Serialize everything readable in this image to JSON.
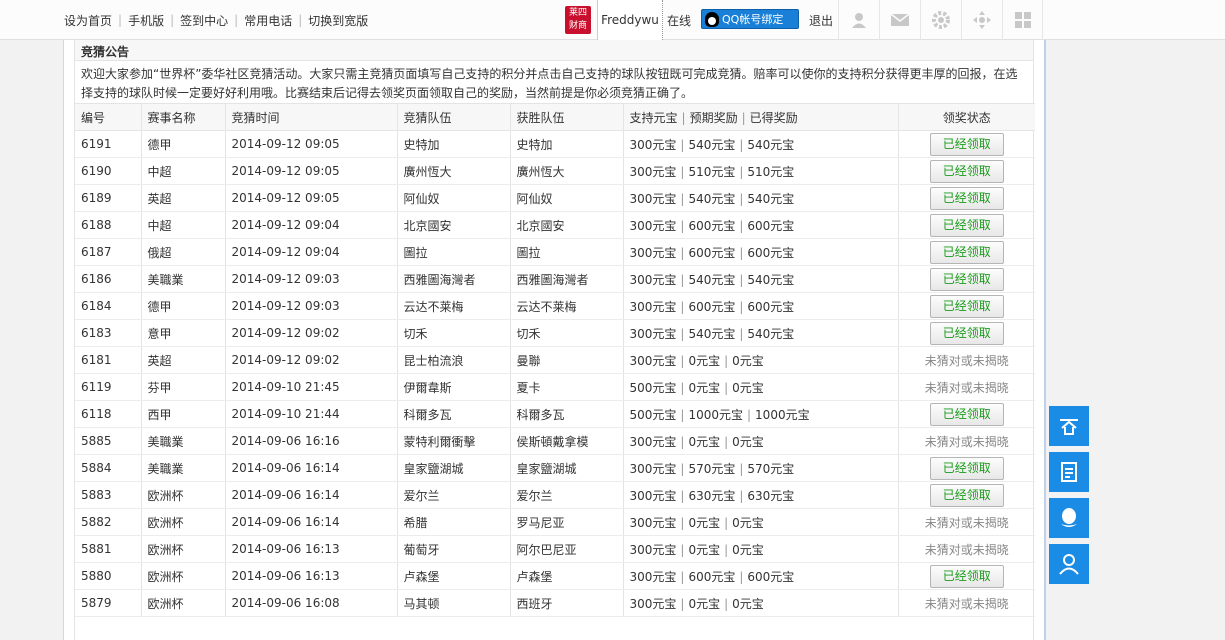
{
  "topbar": {
    "links": [
      "设为首页",
      "手机版",
      "签到中心",
      "常用电话",
      "切换到宽版"
    ],
    "logo_text": "莱四财商",
    "username": "Freddywu",
    "online": "在线",
    "qq_bind": "QQ帐号绑定",
    "logout": "退出"
  },
  "panel": {
    "title": "竞猜公告",
    "notice": "欢迎大家参加“世界杯”委华社区竞猜活动。大家只需主竞猜页面填写自己支持的积分并点击自己支持的球队按钮既可完成竞猜。赔率可以使你的支持积分获得更丰厚的回报，在选择支持的球队时候一定要好好利用哦。比赛结束后记得去领奖页面领取自己的奖励，当然前提是你必须竞猜正确了。"
  },
  "table": {
    "headers": {
      "id": "编号",
      "league": "赛事名称",
      "time": "竞猜时间",
      "team": "竞猜队伍",
      "winner": "获胜队伍",
      "stake": "支持元宝",
      "expected": "预期奖励",
      "earned": "已得奖励",
      "status": "领奖状态"
    },
    "claimed_label": "已经领取",
    "rows": [
      {
        "id": "6191",
        "league": "德甲",
        "time": "2014-09-12 09:05",
        "team": "史特加",
        "winner": "史特加",
        "stake": "300元宝",
        "expected": "540元宝",
        "earned": "540元宝",
        "status": "已经领取",
        "claimed": true
      },
      {
        "id": "6190",
        "league": "中超",
        "time": "2014-09-12 09:05",
        "team": "廣州恆大",
        "winner": "廣州恆大",
        "stake": "300元宝",
        "expected": "510元宝",
        "earned": "510元宝",
        "status": "已经领取",
        "claimed": true
      },
      {
        "id": "6189",
        "league": "英超",
        "time": "2014-09-12 09:05",
        "team": "阿仙奴",
        "winner": "阿仙奴",
        "stake": "300元宝",
        "expected": "540元宝",
        "earned": "540元宝",
        "status": "已经领取",
        "claimed": true
      },
      {
        "id": "6188",
        "league": "中超",
        "time": "2014-09-12 09:04",
        "team": "北京國安",
        "winner": "北京國安",
        "stake": "300元宝",
        "expected": "600元宝",
        "earned": "600元宝",
        "status": "已经领取",
        "claimed": true
      },
      {
        "id": "6187",
        "league": "俄超",
        "time": "2014-09-12 09:04",
        "team": "圖拉",
        "winner": "圖拉",
        "stake": "300元宝",
        "expected": "600元宝",
        "earned": "600元宝",
        "status": "已经领取",
        "claimed": true
      },
      {
        "id": "6186",
        "league": "美職業",
        "time": "2014-09-12 09:03",
        "team": "西雅圖海灣者",
        "winner": "西雅圖海灣者",
        "stake": "300元宝",
        "expected": "540元宝",
        "earned": "540元宝",
        "status": "已经领取",
        "claimed": true
      },
      {
        "id": "6184",
        "league": "德甲",
        "time": "2014-09-12 09:03",
        "team": "云达不莱梅",
        "winner": "云达不莱梅",
        "stake": "300元宝",
        "expected": "600元宝",
        "earned": "600元宝",
        "status": "已经领取",
        "claimed": true
      },
      {
        "id": "6183",
        "league": "意甲",
        "time": "2014-09-12 09:02",
        "team": "切禾",
        "winner": "切禾",
        "stake": "300元宝",
        "expected": "540元宝",
        "earned": "540元宝",
        "status": "已经领取",
        "claimed": true
      },
      {
        "id": "6181",
        "league": "英超",
        "time": "2014-09-12 09:02",
        "team": "昆士柏流浪",
        "winner": "曼聯",
        "stake": "300元宝",
        "expected": "0元宝",
        "earned": "0元宝",
        "status": "未猜对或未揭晓",
        "claimed": false
      },
      {
        "id": "6119",
        "league": "芬甲",
        "time": "2014-09-10 21:45",
        "team": "伊爾韋斯",
        "winner": "夏卡",
        "stake": "500元宝",
        "expected": "0元宝",
        "earned": "0元宝",
        "status": "未猜对或未揭晓",
        "claimed": false
      },
      {
        "id": "6118",
        "league": "西甲",
        "time": "2014-09-10 21:44",
        "team": "科爾多瓦",
        "winner": "科爾多瓦",
        "stake": "500元宝",
        "expected": "1000元宝",
        "earned": "1000元宝",
        "status": "已经领取",
        "claimed": true
      },
      {
        "id": "5885",
        "league": "美職業",
        "time": "2014-09-06 16:16",
        "team": "蒙特利爾衝擊",
        "winner": "侯斯頓戴拿模",
        "stake": "300元宝",
        "expected": "0元宝",
        "earned": "0元宝",
        "status": "未猜对或未揭晓",
        "claimed": false
      },
      {
        "id": "5884",
        "league": "美職業",
        "time": "2014-09-06 16:14",
        "team": "皇家鹽湖城",
        "winner": "皇家鹽湖城",
        "stake": "300元宝",
        "expected": "570元宝",
        "earned": "570元宝",
        "status": "已经领取",
        "claimed": true
      },
      {
        "id": "5883",
        "league": "欧洲杯",
        "time": "2014-09-06 16:14",
        "team": "爱尔兰",
        "winner": "爱尔兰",
        "stake": "300元宝",
        "expected": "630元宝",
        "earned": "630元宝",
        "status": "已经领取",
        "claimed": true
      },
      {
        "id": "5882",
        "league": "欧洲杯",
        "time": "2014-09-06 16:14",
        "team": "希腊",
        "winner": "罗马尼亚",
        "stake": "300元宝",
        "expected": "0元宝",
        "earned": "0元宝",
        "status": "未猜对或未揭晓",
        "claimed": false
      },
      {
        "id": "5881",
        "league": "欧洲杯",
        "time": "2014-09-06 16:13",
        "team": "葡萄牙",
        "winner": "阿尔巴尼亚",
        "stake": "300元宝",
        "expected": "0元宝",
        "earned": "0元宝",
        "status": "未猜对或未揭晓",
        "claimed": false
      },
      {
        "id": "5880",
        "league": "欧洲杯",
        "time": "2014-09-06 16:13",
        "team": "卢森堡",
        "winner": "卢森堡",
        "stake": "300元宝",
        "expected": "600元宝",
        "earned": "600元宝",
        "status": "已经领取",
        "claimed": true
      },
      {
        "id": "5879",
        "league": "欧洲杯",
        "time": "2014-09-06 16:08",
        "team": "马其顿",
        "winner": "西班牙",
        "stake": "300元宝",
        "expected": "0元宝",
        "earned": "0元宝",
        "status": "未猜对或未揭晓",
        "claimed": false
      }
    ]
  },
  "side_tools": [
    {
      "icon": "back-to-top-icon"
    },
    {
      "icon": "document-icon"
    },
    {
      "icon": "qq-penguin-icon"
    },
    {
      "icon": "contact-person-icon"
    }
  ],
  "colors": {
    "accent_blue": "#1a8ce6",
    "claimed_green": "#1a9a1a",
    "logo_red": "#c8102e"
  }
}
